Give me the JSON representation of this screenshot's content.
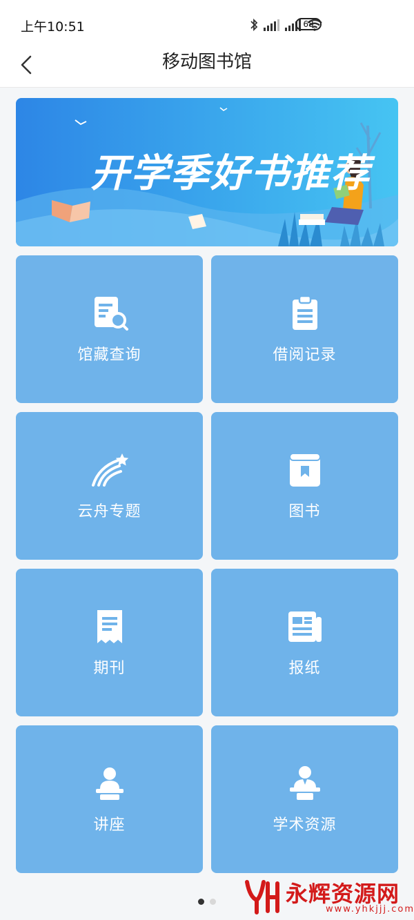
{
  "status_bar": {
    "time": "上午10:51",
    "battery": "68"
  },
  "nav": {
    "title": "移动图书馆"
  },
  "banner": {
    "text": "开学季好书推荐"
  },
  "tiles": [
    {
      "label": "馆藏查询",
      "icon": "catalog-search-icon"
    },
    {
      "label": "借阅记录",
      "icon": "clipboard-icon"
    },
    {
      "label": "云舟专题",
      "icon": "comet-icon"
    },
    {
      "label": "图书",
      "icon": "book-icon"
    },
    {
      "label": "期刊",
      "icon": "journal-icon"
    },
    {
      "label": "报纸",
      "icon": "newspaper-icon"
    },
    {
      "label": "讲座",
      "icon": "lecture-icon"
    },
    {
      "label": "学术资源",
      "icon": "academic-icon"
    }
  ],
  "pager": {
    "total": 2,
    "current": 1
  },
  "watermark": {
    "brand": "永辉资源网",
    "url": "www.yhkjjj.com"
  },
  "colors": {
    "tile": "#6fb3ea",
    "banner_dark": "#2d86e6",
    "banner_light": "#46c4f2",
    "watermark": "#d31a1a"
  }
}
